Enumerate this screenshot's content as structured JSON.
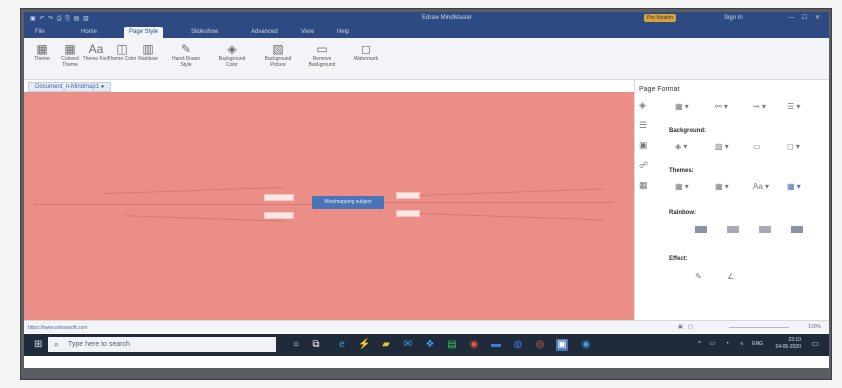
{
  "window": {
    "title": "Edraw MindMaster",
    "pro_badge": "Pro Version",
    "signin": "Sign In",
    "quick_access": "▣ ↶ ↷ ⎙ ⎘ ▤ ▥",
    "window_controls": "—  ☐  ✕"
  },
  "tabs": [
    {
      "label": "File"
    },
    {
      "label": "Home"
    },
    {
      "label": "Page Style"
    },
    {
      "label": "Slideshow"
    },
    {
      "label": "Advanced"
    },
    {
      "label": "View"
    },
    {
      "label": "Help"
    }
  ],
  "ribbon": [
    {
      "label": "Theme",
      "icon": "▦"
    },
    {
      "label": "Colored Theme",
      "icon": "▦"
    },
    {
      "label": "Theme Font",
      "icon": "Aa"
    },
    {
      "label": "Theme Color",
      "icon": "◫"
    },
    {
      "label": "Rainbow",
      "icon": "▥"
    },
    {
      "label": "Hand-Drawn Style",
      "icon": "✎"
    },
    {
      "label": "Background Color",
      "icon": "◈"
    },
    {
      "label": "Background Picture",
      "icon": "▧"
    },
    {
      "label": "Remove Background",
      "icon": "▭"
    },
    {
      "label": "Watermark",
      "icon": "◻"
    }
  ],
  "document_tab": "Document_n-Mindmap1 ●",
  "canvas": {
    "central_topic": "Mindmapping subject",
    "bg_color": "#ec8e88"
  },
  "panel": {
    "title": "Page Format",
    "sections": {
      "background": "Background:",
      "themes": "Themes:",
      "rainbow": "Rainbow:",
      "effect": "Effect:"
    }
  },
  "status": {
    "url": "https://www.edrawsoft.com",
    "zoom": "100%"
  },
  "taskbar": {
    "search_placeholder": "Type here to search",
    "language": "ENG",
    "time": "23:10",
    "date": "24-05-2020"
  },
  "colors": {
    "accent": "#2e4a82",
    "canvas": "#ec8e88",
    "central_node": "#4a74b8"
  }
}
